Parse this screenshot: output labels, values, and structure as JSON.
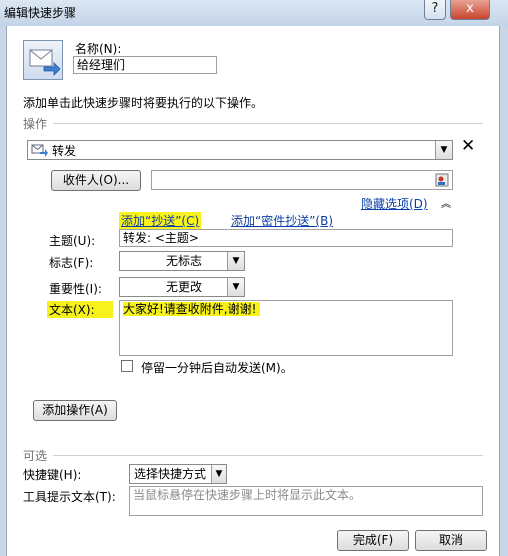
{
  "window": {
    "title": "编辑快速步骤",
    "help_button": "?",
    "close_button": "x"
  },
  "name_section": {
    "label": "名称(N):",
    "value": "给经理们"
  },
  "instruction": "添加单击此快速步骤时将要执行的以下操作。",
  "operations": {
    "group_label": "操作",
    "action": "转发",
    "remove_symbol": "✕",
    "recipient_button": "收件人(O)...",
    "recipient_value": "",
    "hide_options": "隐藏选项(D)",
    "add_cc": "添加“抄送”(C)",
    "add_bcc": "添加“密件抄送”(B)",
    "subject_label": "主题(U):",
    "subject_value": "转发: <主题>",
    "flag_label": "标志(F):",
    "flag_value": "无标志",
    "importance_label": "重要性(I):",
    "importance_value": "无更改",
    "text_label": "文本(X):",
    "text_value": "大家好!请查收附件,谢谢!",
    "wait_checkbox_label": "停留一分钟后自动发送(M)。",
    "wait_checked": false,
    "add_action_button": "添加操作(A)"
  },
  "optional": {
    "group_label": "可选",
    "shortcut_label": "快捷键(H):",
    "shortcut_value": "选择快捷方式",
    "tooltip_label": "工具提示文本(T):",
    "tooltip_placeholder": "当鼠标悬停在快速步骤上时将显示此文本。"
  },
  "footer": {
    "finish_button": "完成(F)",
    "cancel_button": "取消"
  },
  "colors": {
    "highlight": "#f7f21b",
    "link": "#0b3fa8"
  },
  "icons": {
    "envelope": "quick-step-envelope-icon",
    "forward": "forward-icon",
    "remove": "close-x-icon",
    "address_book": "address-book-icon",
    "collapse": "double-chevron-up-icon"
  }
}
